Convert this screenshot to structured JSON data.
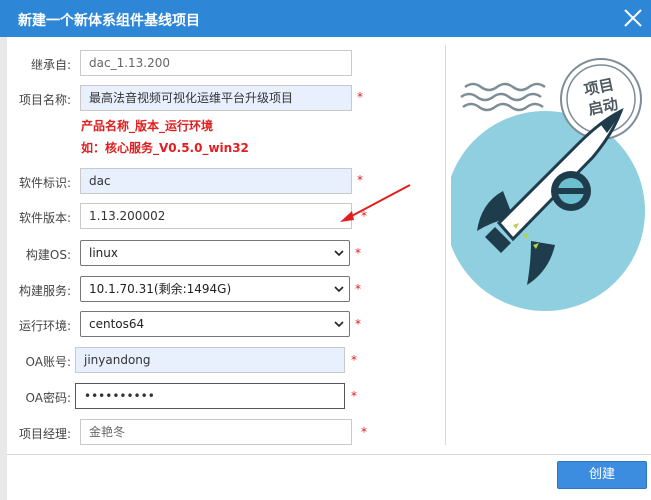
{
  "window": {
    "title": "新建一个新体系组件基线项目"
  },
  "form": {
    "inherit": {
      "label": "继承自:",
      "value": "dac_1.13.200"
    },
    "project_name": {
      "label": "项目名称:",
      "value": "最高法音视频可视化运维平台升级项目",
      "required": "*"
    },
    "hint_line1": "产品名称_版本_运行环境",
    "hint_line2": "如：核心服务_V0.5.0_win32",
    "software_id": {
      "label": "软件标识:",
      "value": "dac",
      "required": "*"
    },
    "software_version": {
      "label": "软件版本:",
      "value": "1.13.200002",
      "required": "*"
    },
    "build_os": {
      "label": "构建OS:",
      "value": "linux",
      "required": "*"
    },
    "build_service": {
      "label": "构建服务:",
      "value": "10.1.70.31(剩余:1494G)",
      "required": "*"
    },
    "runtime_env": {
      "label": "运行环境:",
      "value": "centos64",
      "required": "*"
    },
    "oa_account": {
      "label": "OA账号:",
      "value": "jinyandong",
      "required": "*"
    },
    "oa_password": {
      "label": "OA密码:",
      "value": "••••••••••",
      "required": "*"
    },
    "project_manager": {
      "label": "项目经理:",
      "value": "金艳冬",
      "required": "*"
    }
  },
  "stamp": {
    "line1": "项目",
    "line2": "启动"
  },
  "buttons": {
    "create": "创建"
  },
  "colors": {
    "titlebar": "#2e87d6",
    "accent": "#3c8de0",
    "required": "#e02020",
    "rocket_circle": "#8fcfe0"
  },
  "icons": {
    "close": "close-icon",
    "select": "chevron-down-icon",
    "illustration": "rocket-icon"
  }
}
